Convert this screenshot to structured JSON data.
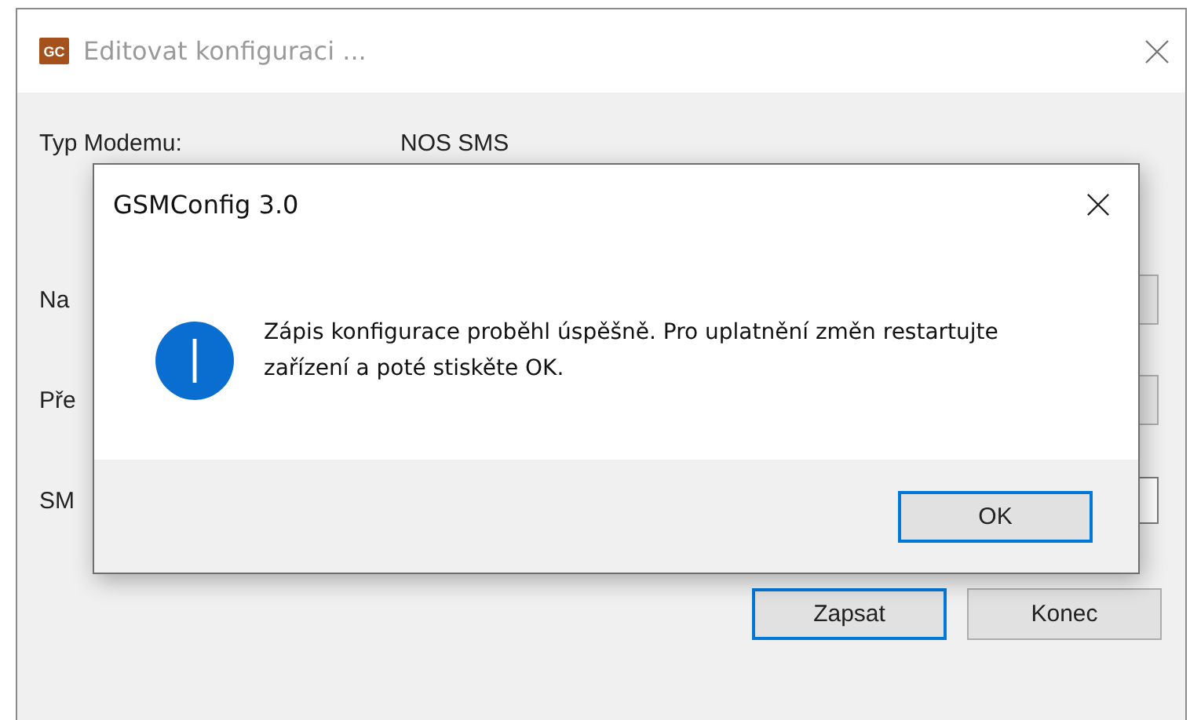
{
  "window": {
    "app_icon": "GC",
    "title": "Editovat konfiguraci ...",
    "fields": [
      {
        "label": "Typ Modemu:",
        "value": "NOS SMS",
        "kind": "text"
      },
      {
        "label": "Na",
        "kind": "dropdown"
      },
      {
        "label": "Pře",
        "kind": "dropdown"
      },
      {
        "label": "SM",
        "kind": "input"
      }
    ],
    "buttons": [
      {
        "label": "Zapsat",
        "default": true
      },
      {
        "label": "Konec",
        "default": false
      }
    ]
  },
  "dialog": {
    "title": "GSMConfig 3.0",
    "message": "Zápis konfigurace proběhl úspěšně. Pro uplatnění změn restartujte zařízení a poté stiskěte OK.",
    "buttons": [
      {
        "label": "OK",
        "default": true
      }
    ]
  }
}
